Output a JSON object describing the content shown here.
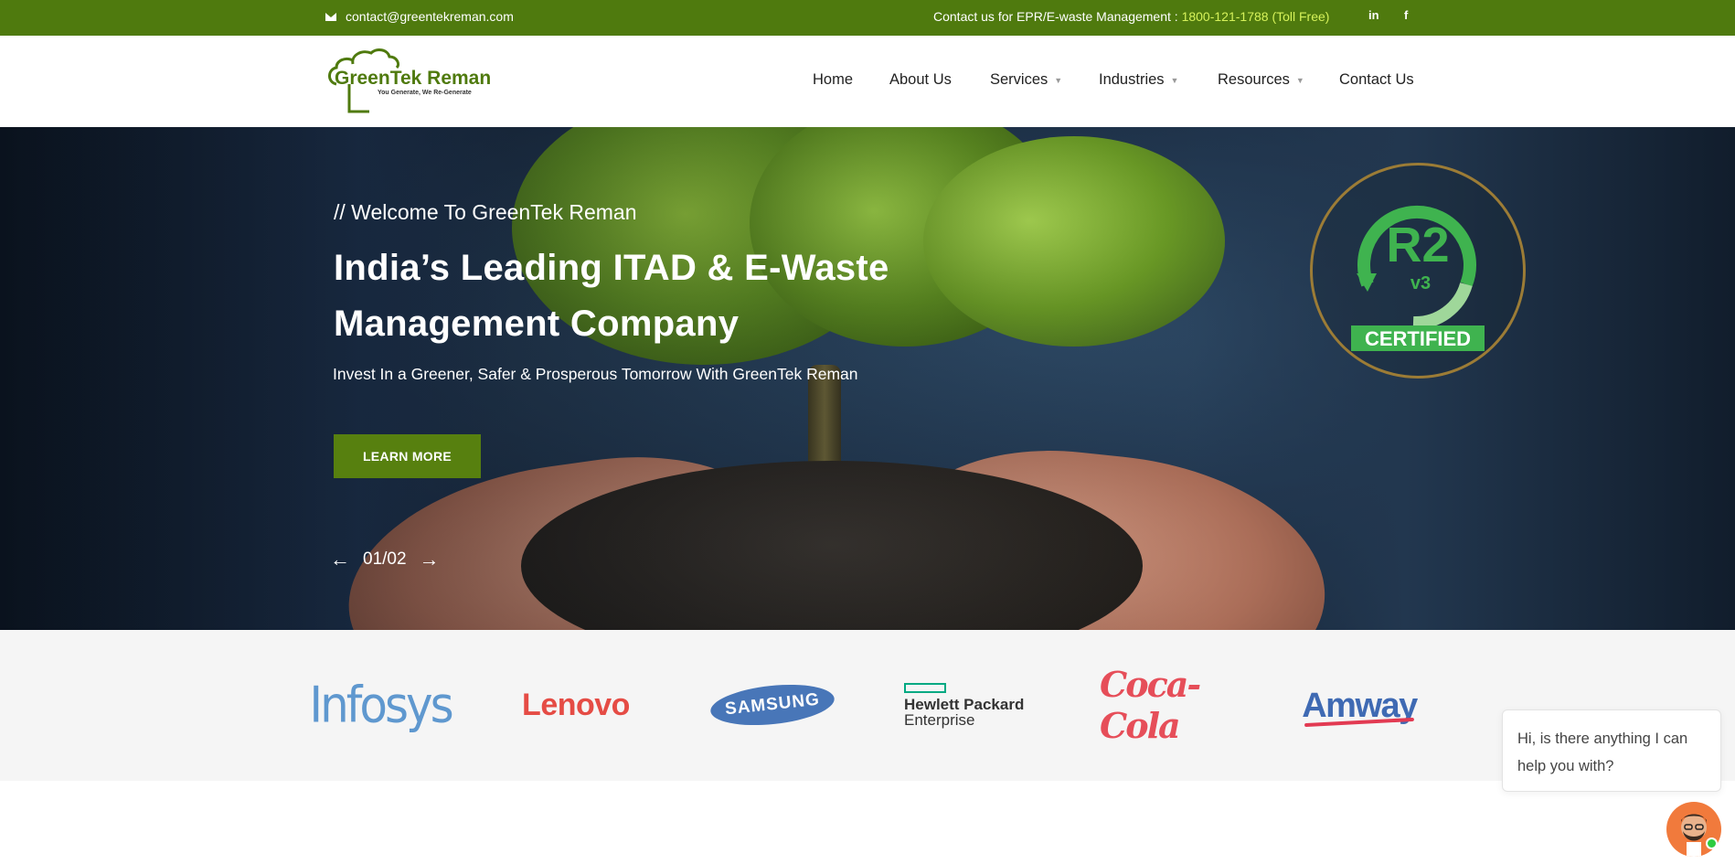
{
  "topbar": {
    "email": "contact@greentekreman.com",
    "contact_prefix": "Contact us for EPR/E-waste Management : ",
    "phone": "1800-121-1788 (Toll Free)",
    "linkedin": "in",
    "facebook": "f"
  },
  "brand": {
    "name": "GreenTek Reman",
    "tagline": "You Generate, We Re-Generate",
    "color": "#4f7a0e"
  },
  "nav": {
    "items": [
      {
        "label": "Home",
        "active": true
      },
      {
        "label": "About Us"
      },
      {
        "label": "Services",
        "dropdown": true
      },
      {
        "label": "Industries",
        "dropdown": true
      },
      {
        "label": "Resources",
        "dropdown": true
      },
      {
        "label": "Contact Us"
      }
    ],
    "caret": "▼"
  },
  "hero": {
    "subtitle": "// Welcome To GreenTek Reman",
    "title": "India’s Leading ITAD & E-Waste Management Company",
    "tagline": "Invest In a Greener, Safer & Prosperous Tomorrow With GreenTek Reman",
    "button": "LEARN MORE",
    "slide_counter": "01/02",
    "prev_arrow": "←",
    "next_arrow": "→"
  },
  "badge": {
    "main": "R2",
    "version": "v3",
    "label": "CERTIFIED"
  },
  "clients": [
    "Infosys",
    "Lenovo",
    "SAMSUNG",
    "Hewlett Packard",
    "Enterprise",
    "Coca-Cola",
    "Amway"
  ],
  "chat": {
    "message": "Hi, is there anything I can help you with?"
  }
}
